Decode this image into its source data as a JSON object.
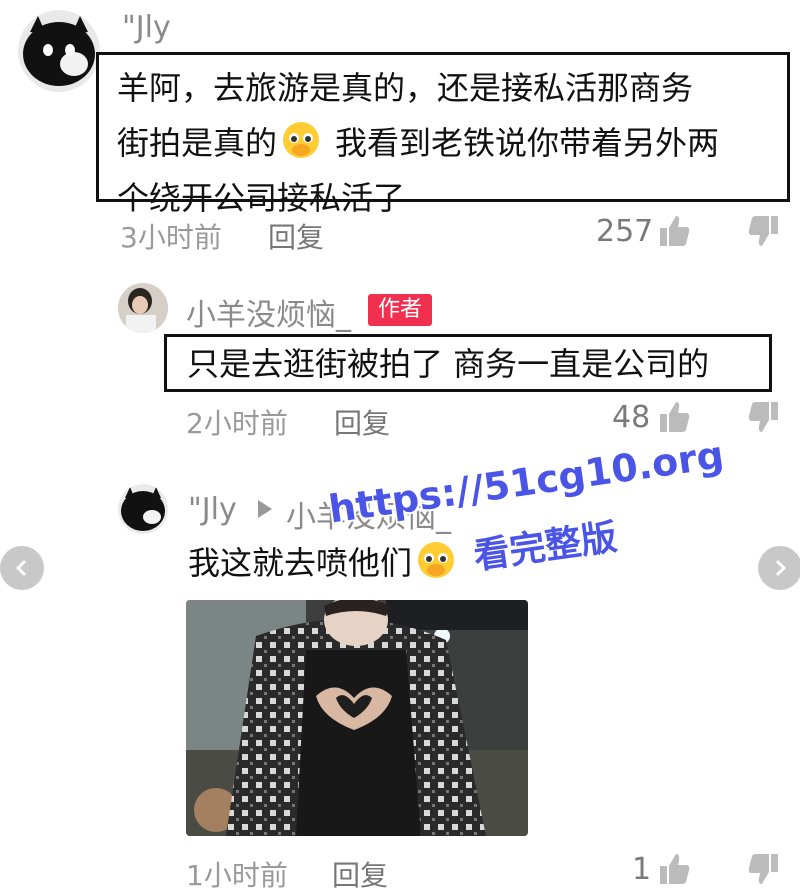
{
  "comments": [
    {
      "username": "\"Jly",
      "lines": [
        "羊阿，去旅游是真的，还是接私活那商务",
        "街拍是真的",
        "我看到老铁说你带着另外两",
        "个绕开公司接私活了"
      ],
      "time": "3小时前",
      "reply_label": "回复",
      "likes": "257"
    },
    {
      "username": "小羊没烦恼_",
      "badge": "作者",
      "text": "只是去逛街被拍了 商务一直是公司的",
      "time": "2小时前",
      "reply_label": "回复",
      "likes": "48"
    },
    {
      "username": "\"Jly",
      "reply_to": "小羊没烦恼_",
      "text": "我这就去喷他们",
      "time": "1小时前",
      "reply_label": "回复",
      "likes": "1"
    }
  ],
  "watermark": {
    "url": "https://51cg10.org",
    "subtitle": "看完整版"
  },
  "colors": {
    "badge": "#f0304e",
    "watermark": "#4a55e8",
    "meta_text": "#9a9a9a"
  },
  "icons": [
    "thumb-up-icon",
    "thumb-down-icon",
    "chevron-left-icon",
    "chevron-right-icon",
    "pleading-face-emoji",
    "play-arrow-icon"
  ]
}
